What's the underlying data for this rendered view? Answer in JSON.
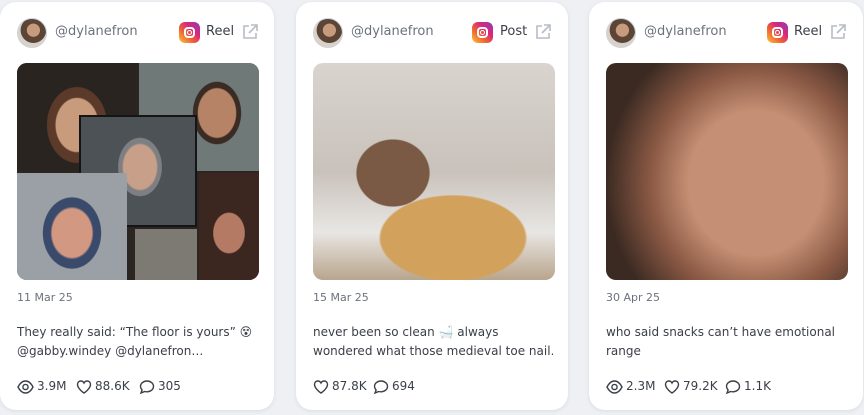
{
  "cards": [
    {
      "handle": "@dylanefron",
      "type_label": "Reel",
      "date": "11 Mar 25",
      "caption_line1": "They really said: “The floor is yours” 😵",
      "caption_line2": "@gabby.windey @dylanefron…",
      "views": "3.9M",
      "likes": "88.6K",
      "comments": "305"
    },
    {
      "handle": "@dylanefron",
      "type_label": "Post",
      "date": "15 Mar 25",
      "caption_line1": "never been so clean 🛁 always",
      "caption_line2": "wondered what those medieval toe nail…",
      "likes": "87.8K",
      "comments": "694"
    },
    {
      "handle": "@dylanefron",
      "type_label": "Reel",
      "date": "30 Apr 25",
      "caption_line1": "who said snacks can’t have emotional",
      "caption_line2": "range",
      "views": "2.3M",
      "likes": "79.2K",
      "comments": "1.1K"
    }
  ],
  "colors": {
    "background": "#eef0f4",
    "card": "#ffffff",
    "muted_text": "#6c727d",
    "body_text": "#3b3f47"
  },
  "icons": [
    "avatar",
    "instagram-icon",
    "external-link-icon",
    "eye-icon",
    "heart-icon",
    "comment-icon"
  ]
}
